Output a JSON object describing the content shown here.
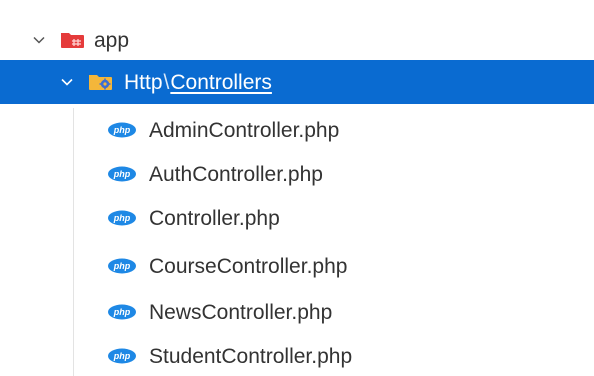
{
  "explorer": {
    "root_folder": {
      "label": "app",
      "icon": "folder-app-icon",
      "expanded": true,
      "icon_color": "#e53b3b"
    },
    "sub_folder": {
      "label_part1": "Http",
      "separator": "\\",
      "label_part2": "Controllers",
      "icon": "folder-gear-icon",
      "expanded": true,
      "selected": true,
      "selection_color": "#0a6bd1"
    },
    "files": [
      {
        "label": "AdminController.php",
        "icon": "php-icon"
      },
      {
        "label": "AuthController.php",
        "icon": "php-icon"
      },
      {
        "label": "Controller.php",
        "icon": "php-icon"
      },
      {
        "label": "CourseController.php",
        "icon": "php-icon"
      },
      {
        "label": "NewsController.php",
        "icon": "php-icon"
      },
      {
        "label": "StudentController.php",
        "icon": "php-icon"
      }
    ],
    "php_icon_color": "#1e88e5"
  }
}
